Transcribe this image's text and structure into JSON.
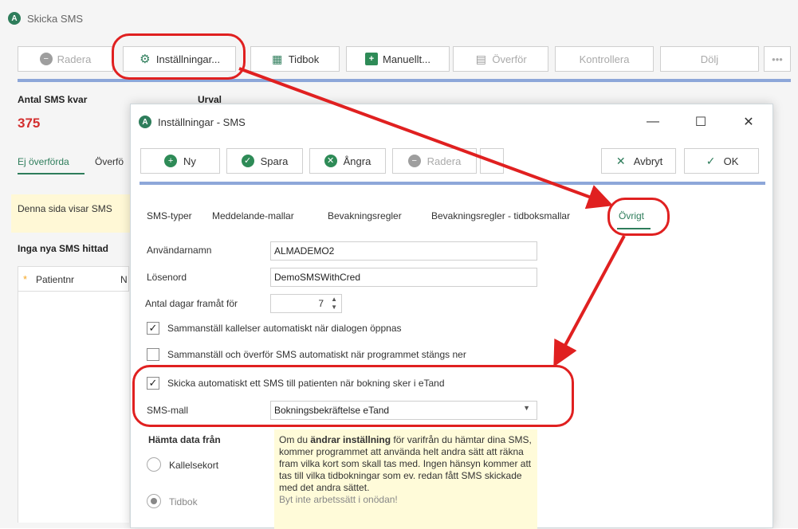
{
  "main_window": {
    "title": "Skicka SMS",
    "app_icon_letter": "A",
    "toolbar": {
      "radera": "Radera",
      "installningar": "Inställningar...",
      "tidbok": "Tidbok",
      "manuellt": "Manuellt...",
      "overfor": "Överför",
      "kontrollera": "Kontrollera",
      "dolj": "Dölj",
      "more": "•••"
    },
    "sms_count_label": "Antal SMS kvar",
    "sms_count": "375",
    "urval_label": "Urval",
    "tabs": {
      "ej_overforda": "Ej överförda",
      "overforda": "Överfö"
    },
    "info_text": "Denna sida visar SMS",
    "no_sms_text": "Inga nya SMS hittad",
    "grid": {
      "marker": "*",
      "columns": [
        "Patientnr",
        "N"
      ]
    }
  },
  "dialog": {
    "title": "Inställningar - SMS",
    "window_controls": {
      "minimize": "—",
      "maximize": "☐",
      "close": "✕"
    },
    "toolbar": {
      "ny": "Ny",
      "spara": "Spara",
      "angra": "Ångra",
      "radera": "Radera",
      "avbryt": "Avbryt",
      "ok": "OK"
    },
    "tabs": [
      "SMS-typer",
      "Meddelande-mallar",
      "Bevakningsregler",
      "Bevakningsregler - tidboksmallar",
      "Övrigt"
    ],
    "active_tab": "Övrigt",
    "fields": {
      "anvandarnamn_label": "Användarnamn",
      "anvandarnamn_value": "ALMADEMO2",
      "losenord_label": "Lösenord",
      "losenord_value": "DemoSMSWithCred",
      "dagar_label": "Antal dagar framåt för",
      "dagar_value": "7"
    },
    "checkboxes": {
      "sammanstall_kallelser": {
        "label": "Sammanställ kallelser automatiskt när dialogen öppnas",
        "checked": true
      },
      "sammanstall_overfor": {
        "label": "Sammanställ och överför SMS automatiskt när programmet stängs ner",
        "checked": false
      },
      "skicka_automatiskt": {
        "label": "Skicka automatiskt ett SMS till patienten när bokning sker i eTand",
        "checked": true
      }
    },
    "sms_mall": {
      "label": "SMS-mall",
      "value": "Bokningsbekräftelse eTand"
    },
    "hamta_data": {
      "label": "Hämta data från",
      "options": [
        "Kallelsekort",
        "Tidbok"
      ],
      "selected": "Tidbok"
    },
    "note": {
      "part1": "Om du ",
      "bold": "ändrar inställning",
      "part2": " för varifrån du hämtar dina SMS, kommer programmet att använda helt andra sätt att räkna fram vilka kort som skall tas med. Ingen hänsyn kommer att tas till vilka tidbokningar som ev. redan fått SMS skickade med det andra sättet.",
      "faded": "Byt inte arbetssätt i onödan!"
    }
  },
  "annotation_color": "#e02020"
}
